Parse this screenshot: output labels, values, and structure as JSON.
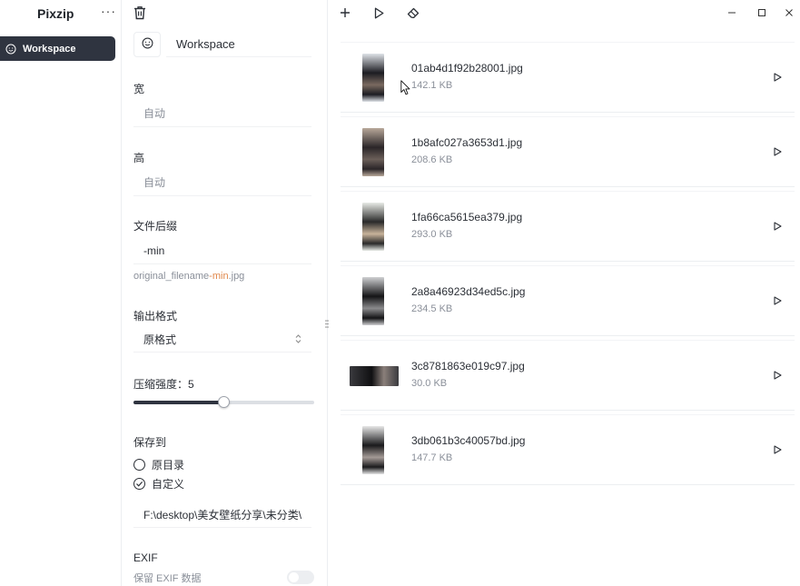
{
  "app": {
    "title": "Pixzip",
    "more_label": "···"
  },
  "sidebar": {
    "items": [
      {
        "label": "Workspace",
        "icon": "smiley-icon",
        "active": true
      }
    ]
  },
  "settings": {
    "workspace_name": "Workspace",
    "width": {
      "label": "宽",
      "placeholder": "自动"
    },
    "height": {
      "label": "高",
      "placeholder": "自动"
    },
    "suffix": {
      "label": "文件后缀",
      "value": "-min",
      "hint_prefix": "original_filename",
      "hint_suffix": "-min",
      "hint_ext": ".jpg"
    },
    "format": {
      "label": "输出格式",
      "selected": "原格式"
    },
    "compression": {
      "label": "压缩强度：5",
      "value": 5,
      "max": 10
    },
    "save_to": {
      "label": "保存到",
      "options": [
        {
          "label": "原目录",
          "checked": false
        },
        {
          "label": "自定义",
          "checked": true
        }
      ],
      "path": "F:\\desktop\\美女壁纸分享\\未分类\\"
    },
    "exif": {
      "label": "EXIF",
      "description": "保留 EXIF 数据",
      "enabled": false
    }
  },
  "files": [
    {
      "name": "01ab4d1f92b28001.jpg",
      "size": "142.1 KB",
      "thumb_colors": [
        "#dfe3e8",
        "#1c1c22",
        "#7a6a60"
      ],
      "wide": false
    },
    {
      "name": "1b8afc027a3653d1.jpg",
      "size": "208.6 KB",
      "thumb_colors": [
        "#b8a89a",
        "#2a2528",
        "#6b5f59"
      ],
      "wide": false
    },
    {
      "name": "1fa66ca5615ea379.jpg",
      "size": "293.0 KB",
      "thumb_colors": [
        "#e8ebe6",
        "#2a2a2a",
        "#c7b39a"
      ],
      "wide": false
    },
    {
      "name": "2a8a46923d34ed5c.jpg",
      "size": "234.5 KB",
      "thumb_colors": [
        "#cfd0d2",
        "#141416",
        "#8a8a8c"
      ],
      "wide": false
    },
    {
      "name": "3c8781863e019c97.jpg",
      "size": "30.0 KB",
      "thumb_colors": [
        "#3a3a3e",
        "#101012",
        "#8a7f7a"
      ],
      "wide": true
    },
    {
      "name": "3db061b3c40057bd.jpg",
      "size": "147.7 KB",
      "thumb_colors": [
        "#e6e6e6",
        "#1a1a1c",
        "#a49a96"
      ],
      "wide": false
    }
  ],
  "colors": {
    "accent": "#2f3440",
    "highlight": "#e0884c",
    "muted": "#8a8f99"
  }
}
